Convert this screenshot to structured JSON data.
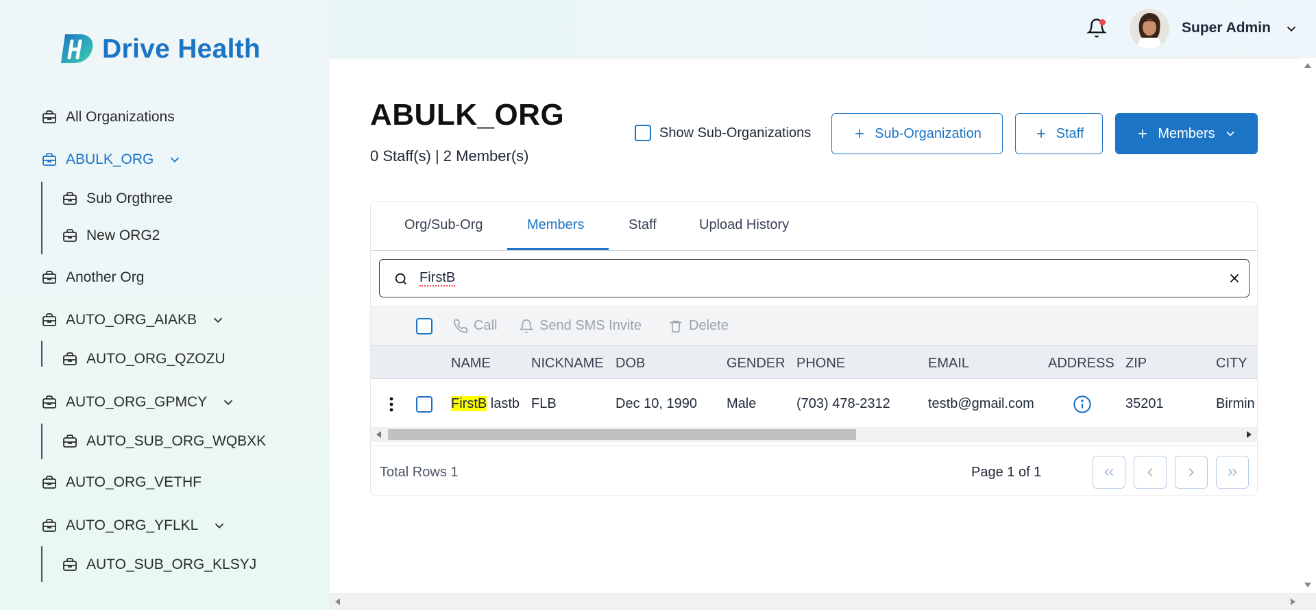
{
  "brand": {
    "name": "Drive Health",
    "color": "#1b74c4"
  },
  "sidebar": {
    "items": [
      {
        "label": "All Organizations",
        "icon": "briefcase-icon"
      },
      {
        "label": "ABULK_ORG",
        "icon": "briefcase-icon",
        "active": true,
        "expanded": true
      },
      {
        "label": "Sub Orgthree",
        "icon": "briefcase-icon"
      },
      {
        "label": "New ORG2",
        "icon": "briefcase-icon"
      },
      {
        "label": "Another Org",
        "icon": "briefcase-icon"
      },
      {
        "label": "AUTO_ORG_AIAKB",
        "icon": "briefcase-icon",
        "expanded": true
      },
      {
        "label": "AUTO_ORG_QZOZU",
        "icon": "briefcase-icon"
      },
      {
        "label": "AUTO_ORG_GPMCY",
        "icon": "briefcase-icon",
        "expanded": true
      },
      {
        "label": "AUTO_SUB_ORG_WQBXK",
        "icon": "briefcase-icon"
      },
      {
        "label": "AUTO_ORG_VETHF",
        "icon": "briefcase-icon"
      },
      {
        "label": "AUTO_ORG_YFLKL",
        "icon": "briefcase-icon",
        "expanded": true
      },
      {
        "label": "AUTO_SUB_ORG_KLSYJ",
        "icon": "briefcase-icon"
      }
    ]
  },
  "header": {
    "notification_icon": "bell-icon",
    "has_unread": true,
    "user_name": "Super Admin"
  },
  "page": {
    "title": "ABULK_ORG",
    "subtitle": "0 Staff(s) | 2 Member(s)",
    "show_sub_orgs_label": "Show Sub-Organizations",
    "show_sub_orgs_checked": false,
    "buttons": {
      "sub_org": "Sub-Organization",
      "staff": "Staff",
      "members": "Members"
    }
  },
  "tabs": [
    {
      "label": "Org/Sub-Org"
    },
    {
      "label": "Members",
      "active": true
    },
    {
      "label": "Staff"
    },
    {
      "label": "Upload History"
    }
  ],
  "search": {
    "value": "FirstB"
  },
  "actions": {
    "call": "Call",
    "sms": "Send SMS Invite",
    "delete": "Delete"
  },
  "table": {
    "columns": [
      "NAME",
      "NICKNAME",
      "DOB",
      "GENDER",
      "PHONE",
      "EMAIL",
      "ADDRESS",
      "ZIP",
      "CITY"
    ],
    "rows": [
      {
        "name_highlight": "FirstB",
        "name_rest": " lastb",
        "nickname": "FLB",
        "dob": "Dec 10, 1990",
        "gender": "Male",
        "phone": "(703) 478-2312",
        "email": "testb@gmail.com",
        "address_icon": "info-icon",
        "zip": "35201",
        "city": "Birmin"
      }
    ]
  },
  "footer": {
    "total": "Total Rows 1",
    "page": "Page 1 of 1"
  }
}
